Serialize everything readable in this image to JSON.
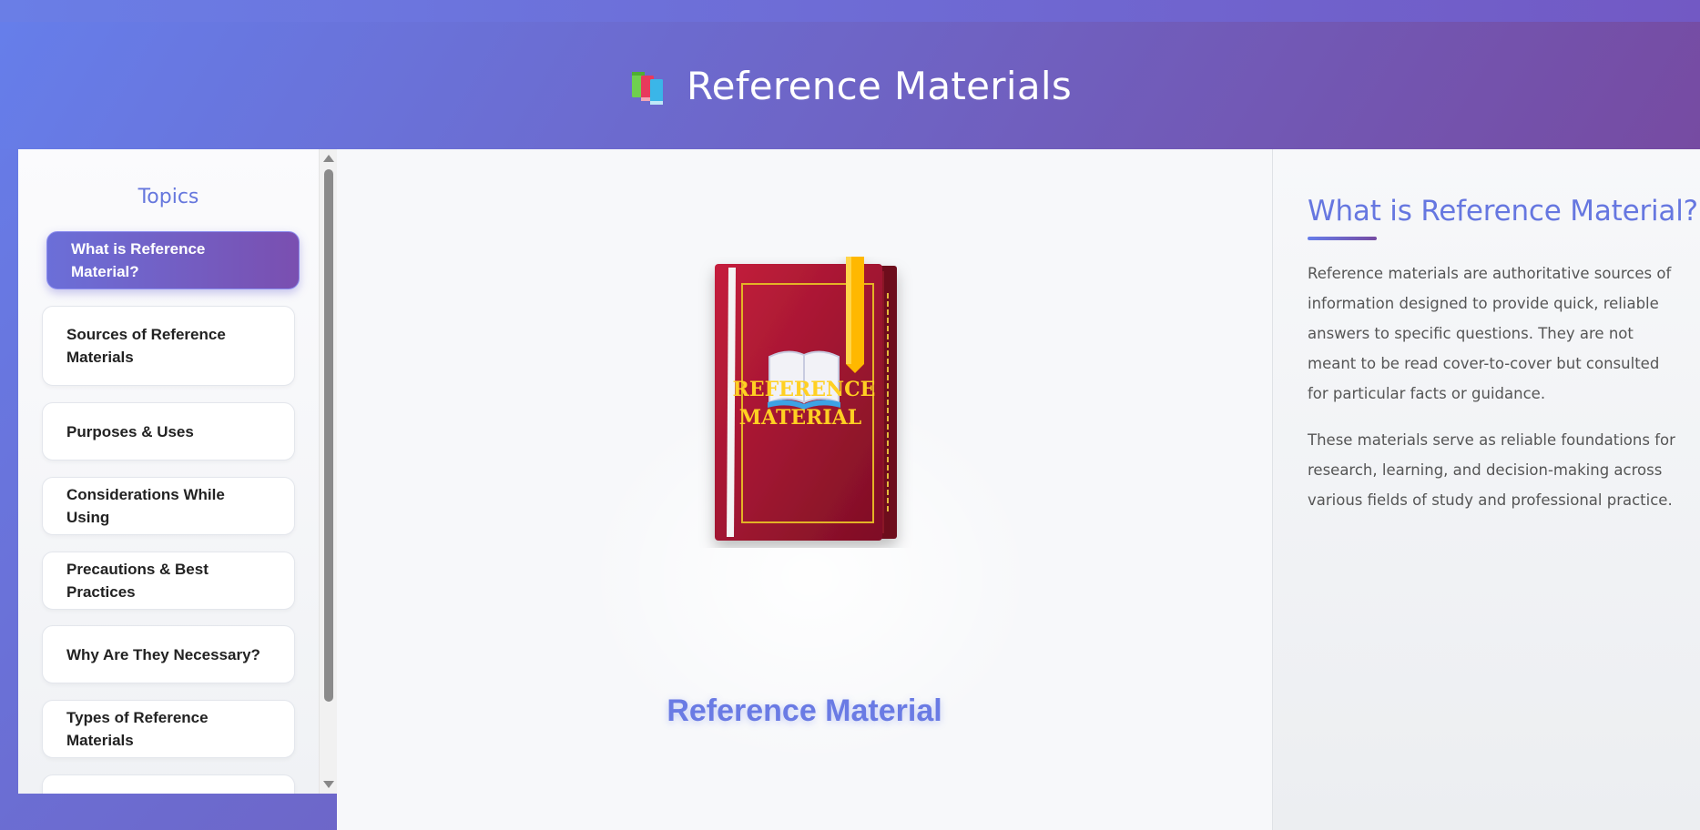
{
  "header": {
    "title": "Reference Materials",
    "logo_icon": "books-icon"
  },
  "sidebar": {
    "title": "Topics",
    "items": [
      {
        "label": "What is Reference Material?",
        "active": true
      },
      {
        "label": "Sources of Reference Materials",
        "active": false
      },
      {
        "label": "Purposes & Uses",
        "active": false
      },
      {
        "label": "Considerations While Using",
        "active": false
      },
      {
        "label": "Precautions & Best Practices",
        "active": false
      },
      {
        "label": "Why Are They Necessary?",
        "active": false
      },
      {
        "label": "Types of Reference Materials",
        "active": false
      },
      {
        "label": "",
        "active": false
      }
    ]
  },
  "stage": {
    "book_cover_text": "REFERENCE MATERIAL",
    "book_cover_line1": "REFERENCE",
    "book_cover_line2": "MATERIAL",
    "book_icon": "open-book-icon",
    "caption": "Reference Material"
  },
  "info": {
    "heading": "What is Reference Material?",
    "paragraphs": [
      "Reference materials are authoritative sources of information designed to provide quick, reliable answers to specific questions. They are not meant to be read cover-to-cover but consulted for particular facts or guidance.",
      "These materials serve as reliable foundations for research, learning, and decision-making across various fields of study and professional practice."
    ]
  },
  "colors": {
    "accent_start": "#667eea",
    "accent_end": "#764ba2",
    "book_red": "#a01830",
    "book_gold": "#f5c518"
  }
}
